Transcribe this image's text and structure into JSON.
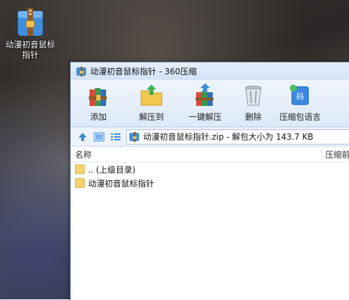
{
  "desktop": {
    "icon_label_line1": "动漫初音鼠标",
    "icon_label_line2": "指针"
  },
  "window": {
    "title": "动漫初音鼠标指针 - 360压缩"
  },
  "toolbar": {
    "add_label": "添加",
    "extract_to_label": "解压到",
    "one_click_extract_label": "一键解压",
    "delete_label": "删除",
    "password_label": "压缩包语言"
  },
  "addressbar": {
    "path_text": "动漫初音鼠标指针.zip - 解包大小为 143.7 KB"
  },
  "columns": {
    "name": "名称",
    "compressed": "压缩前"
  },
  "files": [
    {
      "name": ".. (上级目录)"
    },
    {
      "name": "动漫初音鼠标指针"
    }
  ],
  "colors": {
    "accent": "#3a78c9",
    "folder": "#f6d36b"
  }
}
